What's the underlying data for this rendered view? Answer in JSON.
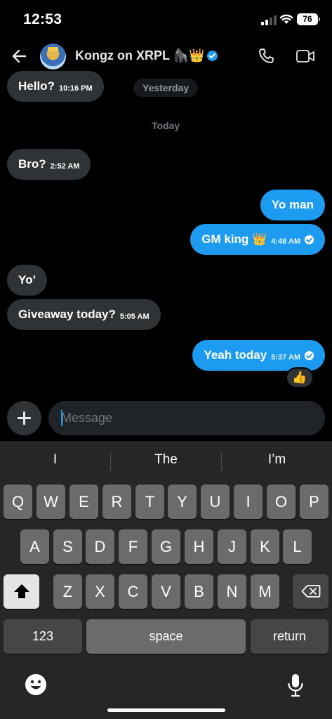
{
  "status": {
    "time": "12:53",
    "battery": "76"
  },
  "header": {
    "contact_name": "Kongz on XRPL 🦍👑"
  },
  "messages": [
    {
      "text": "Hello?",
      "time": "10:16 PM"
    },
    {
      "divider": "Yesterday"
    },
    {
      "divider": "Today"
    },
    {
      "text": "Bro?",
      "time": "2:52 AM"
    },
    {
      "text": "Yo man"
    },
    {
      "text": "GM king 👑",
      "time": "4:48 AM"
    },
    {
      "text": "Yo’"
    },
    {
      "text": "Giveaway today?",
      "time": "5:05 AM"
    },
    {
      "text": "Yeah today",
      "time": "5:37 AM"
    },
    {
      "reaction": "👍"
    }
  ],
  "composer": {
    "placeholder": "Message"
  },
  "keyboard": {
    "suggestions": [
      "I",
      "The",
      "I’m"
    ],
    "row1": [
      "Q",
      "W",
      "E",
      "R",
      "T",
      "Y",
      "U",
      "I",
      "O",
      "P"
    ],
    "row2": [
      "A",
      "S",
      "D",
      "F",
      "G",
      "H",
      "J",
      "K",
      "L"
    ],
    "row3": [
      "Z",
      "X",
      "C",
      "V",
      "B",
      "N",
      "M"
    ],
    "numbers_label": "123",
    "space_label": "space",
    "return_label": "return"
  },
  "colors": {
    "accent": "#1d9bf0",
    "bubble_in": "#2f3336",
    "background": "#000000"
  }
}
